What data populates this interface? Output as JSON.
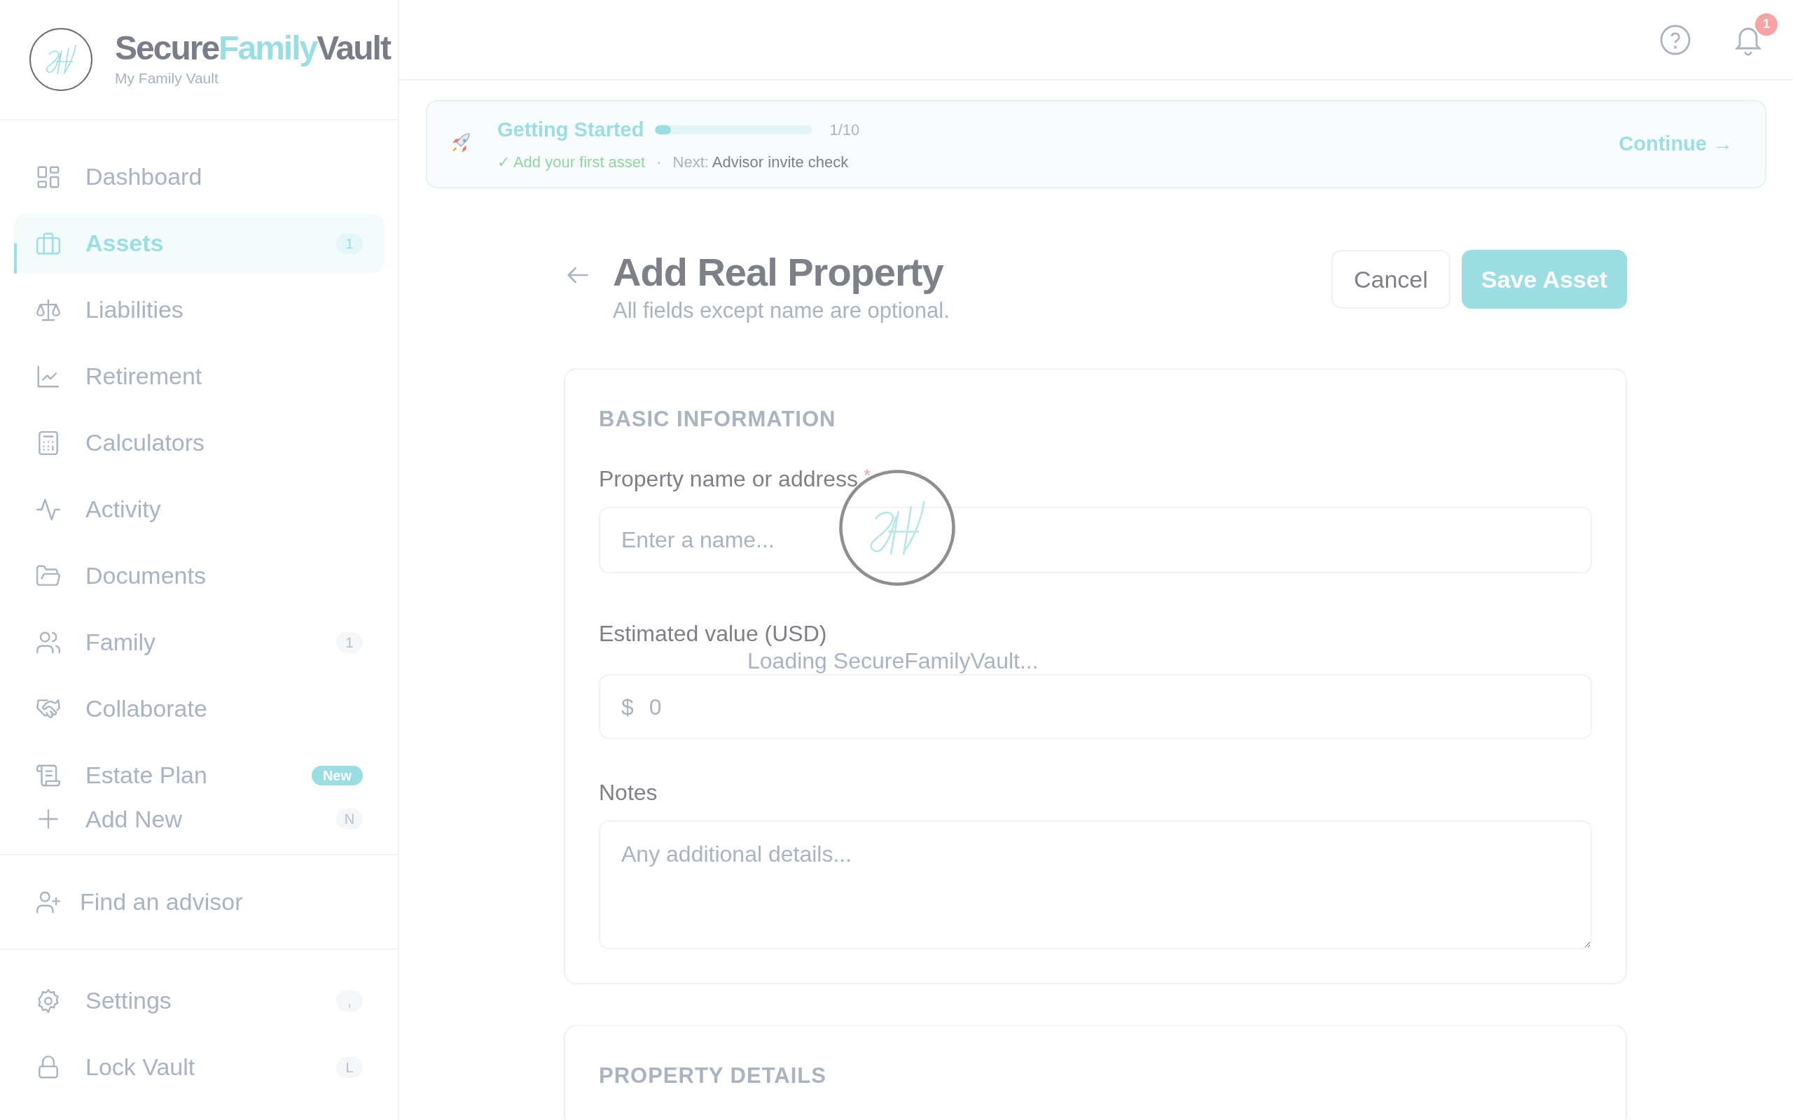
{
  "brand": {
    "name_parts": [
      "Secure",
      "Family",
      "Vault"
    ],
    "subtitle": "My Family Vault"
  },
  "sidebar": {
    "items": [
      {
        "label": "Dashboard",
        "selected": false
      },
      {
        "label": "Assets",
        "selected": true,
        "kind": "count",
        "tag": "1"
      },
      {
        "label": "Liabilities",
        "selected": false
      },
      {
        "label": "Retirement",
        "selected": false
      },
      {
        "label": "Calculators",
        "selected": false
      },
      {
        "label": "Activity",
        "selected": false
      },
      {
        "label": "Documents",
        "selected": false
      },
      {
        "label": "Family",
        "selected": false,
        "kind": "count",
        "tag": "1"
      },
      {
        "label": "Collaborate",
        "selected": false
      },
      {
        "label": "Estate Plan",
        "selected": false,
        "kind": "new",
        "tag": "New"
      },
      {
        "label": "Add New",
        "selected": false,
        "kind": "shortcut",
        "tag": "N"
      }
    ],
    "advisor": "Find an advisor",
    "footer_items": [
      {
        "label": "Settings",
        "shortcut": ","
      },
      {
        "label": "Lock Vault",
        "shortcut": "L"
      }
    ]
  },
  "topbar": {
    "notification_count": "1"
  },
  "onboarding": {
    "title": "Getting Started",
    "level": 0.1,
    "progress": "1/10",
    "done": "✓ Add your first asset",
    "separator": "·",
    "next_label": "Next:",
    "next_step": "Advisor invite check",
    "action": "Continue →"
  },
  "form": {
    "title": "Add Real Property",
    "subtitle": "All fields except name are optional.",
    "buttons": [
      "Cancel",
      "Save Asset"
    ],
    "sections": [
      {
        "heading": "BASIC INFORMATION",
        "fields": [
          {
            "kind": "text",
            "label": "Property name or address",
            "required_mark": "*",
            "placeholder": "Enter a name..."
          },
          {
            "kind": "money",
            "label": "Estimated value (USD)",
            "prefix": "$",
            "placeholder": "0"
          },
          {
            "kind": "textarea",
            "label": "Notes",
            "placeholder": "Any additional details..."
          }
        ]
      },
      {
        "heading": "PROPERTY DETAILS"
      }
    ]
  },
  "loading": {
    "text": "Loading SecureFamilyVault..."
  }
}
